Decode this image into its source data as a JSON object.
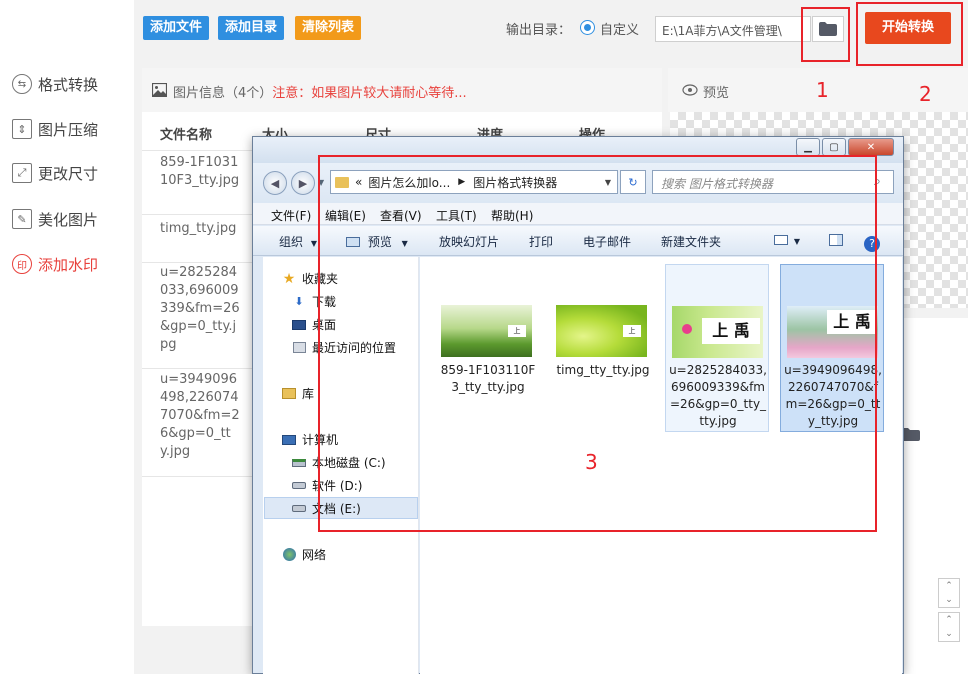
{
  "toolbar": {
    "add_file": "添加文件",
    "add_dir": "添加目录",
    "clear_list": "清除列表",
    "output_label": "输出目录：",
    "custom_label": "自定义",
    "path_value": "E:\\1A菲方\\A文件管理\\",
    "convert": "开始转换"
  },
  "nav": [
    {
      "label": "格式转换",
      "icon": "format-convert-icon"
    },
    {
      "label": "图片压缩",
      "icon": "compress-icon"
    },
    {
      "label": "更改尺寸",
      "icon": "resize-icon"
    },
    {
      "label": "美化图片",
      "icon": "beautify-icon"
    },
    {
      "label": "添加水印",
      "icon": "watermark-icon"
    }
  ],
  "info": {
    "title": "图片信息（4个）",
    "note": "注意：如果图片较大请耐心等待...",
    "columns": [
      "文件名称",
      "大小",
      "尺寸",
      "进度",
      "操作"
    ],
    "files": [
      "859-1F103110F3_tty.jpg",
      "timg_tty.jpg",
      "u=2825284033,696009339&fm=26&gp=0_tty.jpg",
      "u=3949096498,2260747070&fm=26&gp=0_tty.jpg"
    ]
  },
  "preview": {
    "title": "预览"
  },
  "annotations": [
    "1",
    "2",
    "3"
  ],
  "dialog": {
    "address_prefix": "«",
    "address_seg1": "图片怎么加lo...",
    "address_seg2": "图片格式转换器",
    "search_placeholder": "搜索 图片格式转换器",
    "menus": [
      "文件(F)",
      "编辑(E)",
      "查看(V)",
      "工具(T)",
      "帮助(H)"
    ],
    "commands": {
      "organize": "组织",
      "preview": "预览",
      "slideshow": "放映幻灯片",
      "print": "打印",
      "email": "电子邮件",
      "new_folder": "新建文件夹"
    },
    "tree": {
      "favorites": "收藏夹",
      "downloads": "下载",
      "desktop": "桌面",
      "recent": "最近访问的位置",
      "libraries": "库",
      "computer": "计算机",
      "drive_c": "本地磁盘 (C:)",
      "drive_d": "软件 (D:)",
      "drive_e": "文档 (E:)",
      "network": "网络"
    },
    "files": [
      "859-1F103110F3_tty_tty.jpg",
      "timg_tty_tty.jpg",
      "u=2825284033,696009339&fm=26&gp=0_tty_tty.jpg",
      "u=3949096498,2260747070&fm=26&gp=0_tty_tty.jpg"
    ]
  },
  "colors": {
    "accent_red": "#e8413c",
    "convert_button": "#e8481e",
    "blue_button": "#2f8fe0",
    "orange_button": "#f29a1a",
    "annotation": "#e8232a"
  }
}
